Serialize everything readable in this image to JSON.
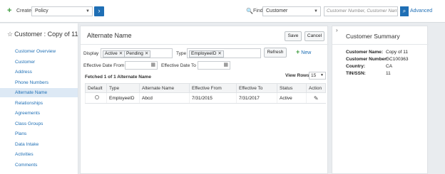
{
  "topbar": {
    "create_label": "Create",
    "create_value": "Policy",
    "go_icon": "chevron-right-icon",
    "find_label": "Find",
    "find_value": "Customer",
    "search_placeholder": "Customer Number, Customer Name",
    "advanced_label": "Advanced"
  },
  "page": {
    "title": "Customer : Copy of 11"
  },
  "nav": {
    "items": [
      {
        "label": "Customer Overview"
      },
      {
        "label": "Customer"
      },
      {
        "label": "Address"
      },
      {
        "label": "Phone Numbers"
      },
      {
        "label": "Alternate Name",
        "active": true
      },
      {
        "label": "Relationships"
      },
      {
        "label": "Agreements"
      },
      {
        "label": "Class Groups"
      },
      {
        "label": "Plans"
      },
      {
        "label": "Data Intake"
      },
      {
        "label": "Activities"
      },
      {
        "label": "Comments"
      }
    ]
  },
  "main": {
    "title": "Alternate Name",
    "save_label": "Save",
    "cancel_label": "Cancel",
    "display_label": "Display",
    "display_tags": [
      "Active",
      "Pending"
    ],
    "type_label": "Type",
    "type_tags": [
      "EmployeeID"
    ],
    "refresh_label": "Refresh",
    "new_label": "New",
    "eff_from_label": "Effective Date From",
    "eff_to_label": "Effective Date To",
    "fetched_text": "Fetched 1 of 1 Alternate Name",
    "view_rows_label": "View Rows",
    "view_rows_value": "15",
    "table": {
      "headers": [
        "Default",
        "Type",
        "Alternate Name",
        "Effective From",
        "Effective To",
        "Status",
        "Action"
      ],
      "rows": [
        {
          "type": "EmployeeID",
          "alt_name": "Abcd",
          "eff_from": "7/31/2015",
          "eff_to": "7/31/2017",
          "status": "Active"
        }
      ]
    }
  },
  "summary": {
    "title": "Customer Summary",
    "name_label": "Customer Name:",
    "name_value": "Copy of 11",
    "number_label": "Customer Number:",
    "number_value": "GC100363",
    "country_label": "Country:",
    "country_value": "CA",
    "tin_label": "TIN/SSN:",
    "tin_value": "11"
  },
  "colors": {
    "accent": "#1f6fb5",
    "create_green": "#3c9b3c",
    "active_nav_bg": "#dde9f5"
  }
}
